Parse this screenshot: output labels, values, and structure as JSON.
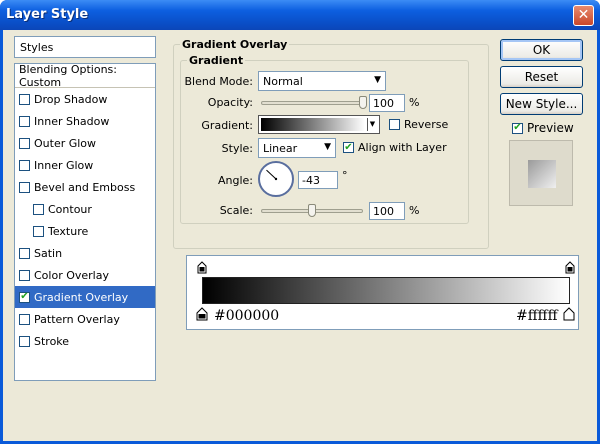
{
  "window": {
    "title": "Layer Style",
    "close_glyph": "✕"
  },
  "styles_panel": {
    "header": "Styles",
    "items": [
      {
        "label": "Blending Options: Custom",
        "has_checkbox": false,
        "checked": false,
        "indent": false
      },
      {
        "label": "Drop Shadow",
        "has_checkbox": true,
        "checked": false,
        "indent": false
      },
      {
        "label": "Inner Shadow",
        "has_checkbox": true,
        "checked": false,
        "indent": false
      },
      {
        "label": "Outer Glow",
        "has_checkbox": true,
        "checked": false,
        "indent": false
      },
      {
        "label": "Inner Glow",
        "has_checkbox": true,
        "checked": false,
        "indent": false
      },
      {
        "label": "Bevel and Emboss",
        "has_checkbox": true,
        "checked": false,
        "indent": false
      },
      {
        "label": "Contour",
        "has_checkbox": true,
        "checked": false,
        "indent": true
      },
      {
        "label": "Texture",
        "has_checkbox": true,
        "checked": false,
        "indent": true
      },
      {
        "label": "Satin",
        "has_checkbox": true,
        "checked": false,
        "indent": false
      },
      {
        "label": "Color Overlay",
        "has_checkbox": true,
        "checked": false,
        "indent": false
      },
      {
        "label": "Gradient Overlay",
        "has_checkbox": true,
        "checked": true,
        "indent": false,
        "selected": true
      },
      {
        "label": "Pattern Overlay",
        "has_checkbox": true,
        "checked": false,
        "indent": false
      },
      {
        "label": "Stroke",
        "has_checkbox": true,
        "checked": false,
        "indent": false
      }
    ]
  },
  "gradient_overlay": {
    "group_title": "Gradient Overlay",
    "inner_title": "Gradient",
    "blend_mode": {
      "label": "Blend Mode:",
      "value": "Normal"
    },
    "opacity": {
      "label": "Opacity:",
      "value": "100",
      "unit": "%",
      "level": 100
    },
    "gradient": {
      "label": "Gradient:",
      "colors": [
        "#000000",
        "#ffffff"
      ]
    },
    "reverse": {
      "label": "Reverse",
      "checked": false
    },
    "style": {
      "label": "Style:",
      "value": "Linear"
    },
    "align": {
      "label": "Align with Layer",
      "checked": true
    },
    "angle": {
      "label": "Angle:",
      "value": "-43",
      "unit": "°",
      "degrees": -43
    },
    "scale": {
      "label": "Scale:",
      "value": "100",
      "unit": "%",
      "level": 0.5
    }
  },
  "gradient_editor": {
    "start_color": "#000000",
    "end_color": "#ffffff",
    "start_label": "#000000",
    "end_label": "#ffffff"
  },
  "buttons": {
    "ok": "OK",
    "reset": "Reset",
    "new_style": "New Style...",
    "preview": {
      "label": "Preview",
      "checked": true
    }
  },
  "colors": {
    "selection": "#316ac5",
    "check": "#21a121"
  }
}
